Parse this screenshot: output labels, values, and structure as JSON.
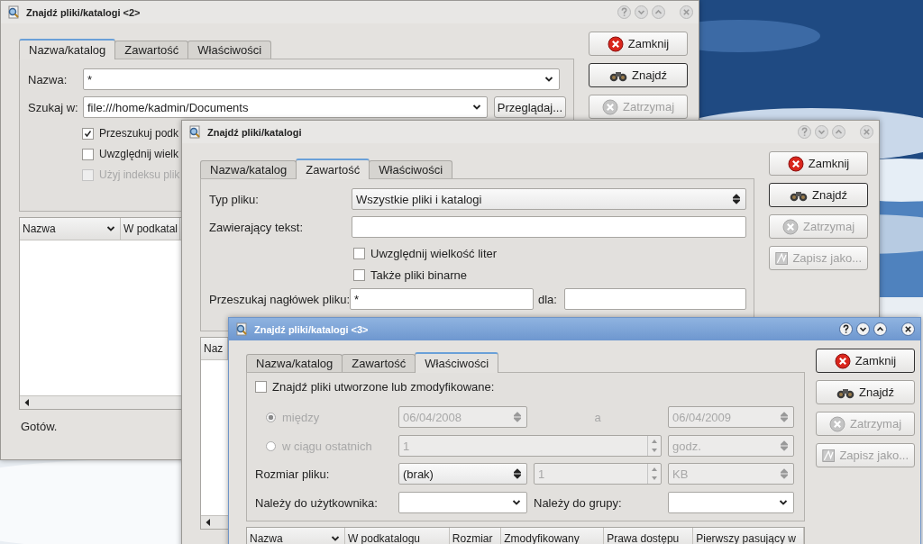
{
  "windows": [
    {
      "title": "Znajdź pliki/katalogi <2>",
      "active": false,
      "tabs": [
        {
          "label": "Nazwa/katalog",
          "selected": true
        },
        {
          "label": "Zawartość",
          "selected": false
        },
        {
          "label": "Właściwości",
          "selected": false
        }
      ],
      "form": {
        "kind": "name",
        "fields": [
          {
            "label": "Nazwa:",
            "value": "*"
          },
          {
            "label": "Szukaj w:",
            "value": "file:///home/kadmin/Documents",
            "browse": "Przeglądaj..."
          }
        ],
        "checkboxes": [
          {
            "label": "Przeszukuj podk",
            "checked": true,
            "disabled": false
          },
          {
            "label": "Uwzględnij wielk",
            "checked": false,
            "disabled": false
          },
          {
            "label": "Użyj indeksu plik",
            "checked": false,
            "disabled": true
          }
        ]
      },
      "buttons": [
        {
          "label": "Zamknij",
          "kind": "close",
          "disabled": false,
          "default": false
        },
        {
          "label": "Znajdź",
          "kind": "find",
          "disabled": false,
          "default": true
        },
        {
          "label": "Zatrzymaj",
          "kind": "stop",
          "disabled": true,
          "default": false
        }
      ],
      "results": {
        "columns": [
          {
            "label": "Nazwa",
            "sorted": true
          },
          {
            "label": "W podkatal"
          }
        ]
      },
      "status": "Gotów."
    },
    {
      "title": "Znajdź pliki/katalogi",
      "active": false,
      "tabs": [
        {
          "label": "Nazwa/katalog",
          "selected": false
        },
        {
          "label": "Zawartość",
          "selected": true
        },
        {
          "label": "Właściwości",
          "selected": false
        }
      ],
      "form": {
        "kind": "contents",
        "file_type": {
          "label": "Typ pliku:",
          "value": "Wszystkie pliki i katalogi"
        },
        "text": {
          "label": "Zawierający tekst:"
        },
        "checkboxes": [
          {
            "label": "Uwzględnij wielkość liter",
            "checked": false,
            "disabled": false
          },
          {
            "label": "Także pliki binarne",
            "checked": false,
            "disabled": false
          }
        ],
        "header": {
          "label": "Przeszukaj nagłówek pliku:",
          "value": "*",
          "for_label": "dla:"
        }
      },
      "buttons": [
        {
          "label": "Zamknij",
          "kind": "close",
          "disabled": false,
          "default": false
        },
        {
          "label": "Znajdź",
          "kind": "find",
          "disabled": false,
          "default": true
        },
        {
          "label": "Zatrzymaj",
          "kind": "stop",
          "disabled": true,
          "default": false
        },
        {
          "label": "Zapisz jako...",
          "kind": "save",
          "disabled": true,
          "default": false
        }
      ],
      "results": {
        "columns": [
          {
            "label": "Naz"
          }
        ]
      }
    },
    {
      "title": "Znajdź pliki/katalogi <3>",
      "active": true,
      "tabs": [
        {
          "label": "Nazwa/katalog",
          "selected": false
        },
        {
          "label": "Zawartość",
          "selected": false
        },
        {
          "label": "Właściwości",
          "selected": true
        }
      ],
      "form": {
        "kind": "properties",
        "date_filter": {
          "label": "Znajdź pliki utworzone lub zmodyfikowane:",
          "checked": false
        },
        "between": {
          "label": "między",
          "selected": true,
          "from": "06/04/2008",
          "separator": "a",
          "to": "06/04/2009"
        },
        "within": {
          "label": "w ciągu ostatnich",
          "selected": false,
          "value": "1",
          "unit": "godz."
        },
        "size": {
          "label": "Rozmiar pliku:",
          "mode": "(brak)",
          "value": "1",
          "unit": "KB",
          "value_disabled": true
        },
        "owner": {
          "label": "Należy do użytkownika:"
        },
        "group": {
          "label": "Należy do grupy:"
        }
      },
      "buttons": [
        {
          "label": "Zamknij",
          "kind": "close",
          "disabled": false,
          "default": true
        },
        {
          "label": "Znajdź",
          "kind": "find",
          "disabled": false,
          "default": false
        },
        {
          "label": "Zatrzymaj",
          "kind": "stop",
          "disabled": true,
          "default": false
        },
        {
          "label": "Zapisz jako...",
          "kind": "save",
          "disabled": true,
          "default": false
        }
      ],
      "results": {
        "columns": [
          {
            "label": "Nazwa",
            "sorted": true
          },
          {
            "label": "W podkatalogu"
          },
          {
            "label": "Rozmiar"
          },
          {
            "label": "Zmodyfikowany"
          },
          {
            "label": "Prawa dostępu"
          },
          {
            "label": "Pierwszy pasujący w"
          }
        ]
      }
    }
  ]
}
